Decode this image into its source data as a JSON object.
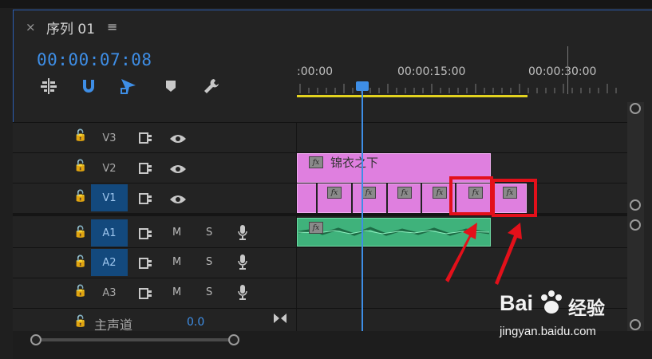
{
  "tab": {
    "close_icon": "×",
    "title": "序列 01",
    "menu_icon": "≡"
  },
  "timecode": "00:00:07:08",
  "ruler": {
    "labels": [
      ":00:00",
      "00:00:15:00",
      "00:00:30:00"
    ]
  },
  "tracks": {
    "video": [
      {
        "name": "V3",
        "active": false
      },
      {
        "name": "V2",
        "active": false
      },
      {
        "name": "V1",
        "active": true
      }
    ],
    "audio": [
      {
        "name": "A1",
        "m": "M",
        "s": "S",
        "active": true
      },
      {
        "name": "A2",
        "m": "M",
        "s": "S",
        "active": true
      },
      {
        "name": "A3",
        "m": "M",
        "s": "S",
        "active": false
      }
    ]
  },
  "master": {
    "label": "主声道",
    "value": "0.0"
  },
  "clips": {
    "v2_title": "锦衣之下",
    "fx_label": "fx"
  },
  "watermark": {
    "brand_left": "Bai",
    "brand_right": "经验",
    "url": "jingyan.baidu.com"
  },
  "colors": {
    "accent": "#3e8ee6",
    "clip_video": "#df7fdf",
    "clip_audio": "#3fb27b",
    "highlight": "#e3101a",
    "workbar": "#e2d21f"
  }
}
